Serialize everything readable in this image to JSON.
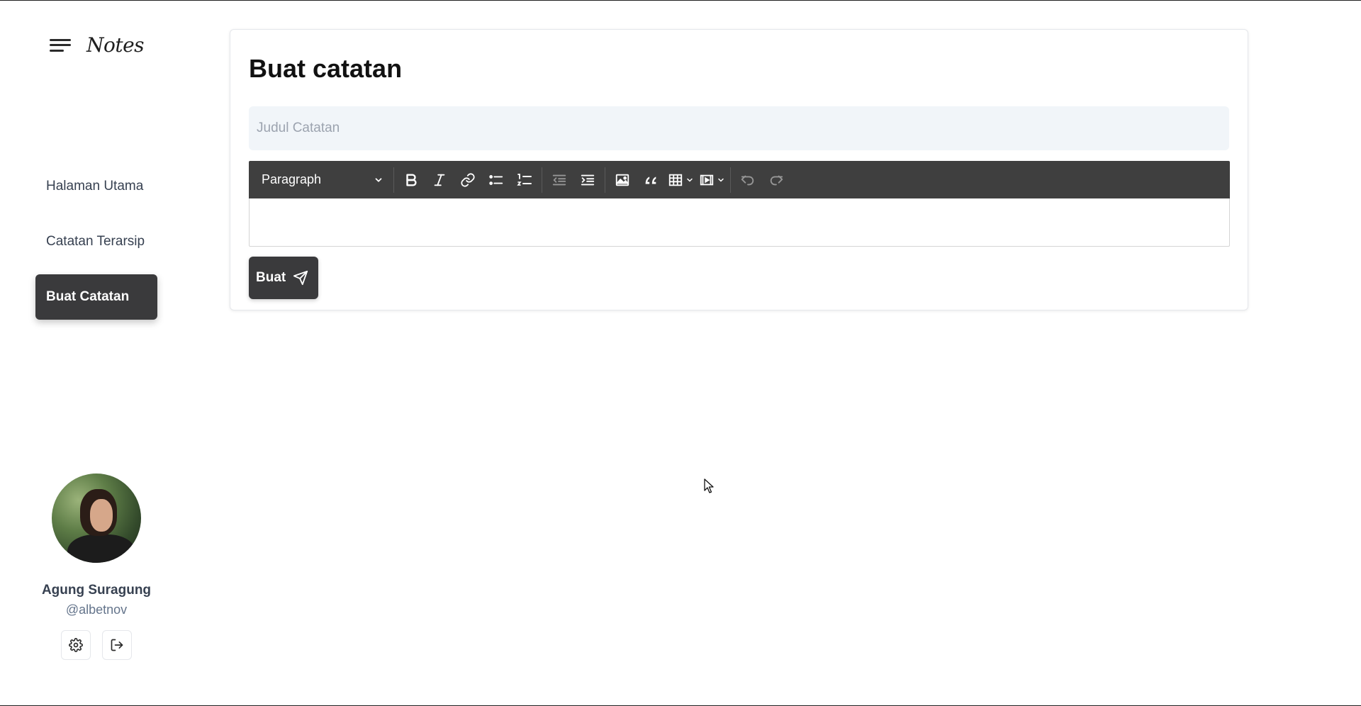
{
  "app": {
    "brand_name": "Notes"
  },
  "sidebar": {
    "items": [
      {
        "label": "Halaman Utama",
        "active": false
      },
      {
        "label": "Catatan Terarsip",
        "active": false
      },
      {
        "label": "Buat Catatan",
        "active": true
      }
    ]
  },
  "profile": {
    "name": "Agung Suragung",
    "handle": "@albetnov",
    "actions": [
      "gear-icon",
      "logout-icon"
    ]
  },
  "main": {
    "title": "Buat catatan",
    "title_input": {
      "placeholder": "Judul Catatan",
      "value": ""
    },
    "editor": {
      "format_select": "Paragraph",
      "toolbar_icons": [
        "bold-icon",
        "italic-icon",
        "link-icon",
        "bulleted-list-icon",
        "numbered-list-icon",
        "outdent-icon",
        "indent-icon",
        "image-icon",
        "quote-icon",
        "table-icon",
        "media-icon",
        "undo-icon",
        "redo-icon"
      ],
      "content": ""
    },
    "submit_label": "Buat"
  },
  "colors": {
    "accent_dark": "#3a3a3c",
    "toolbar_bg": "#3f3f3f",
    "input_bg": "#f1f5f9",
    "handle_text": "#64748b"
  }
}
